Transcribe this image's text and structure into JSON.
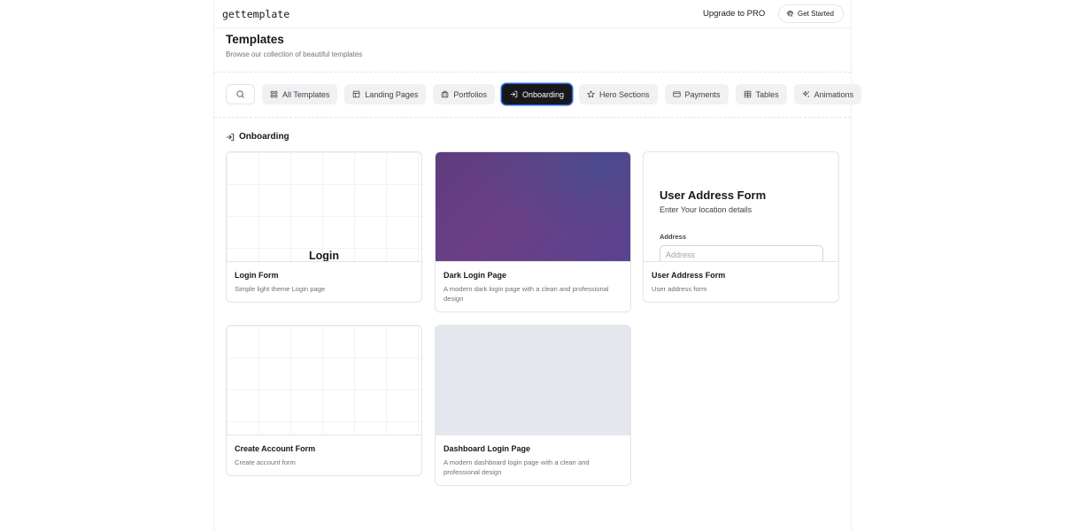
{
  "header": {
    "brand": "gettemplate",
    "upgrade_label": "Upgrade to PRO",
    "cta_label": "Get Started"
  },
  "page": {
    "title": "Templates",
    "subtitle": "Browse our collection of beautiful templates"
  },
  "tabs": [
    {
      "label": "All Templates",
      "icon": "grid-icon",
      "active": false
    },
    {
      "label": "Landing Pages",
      "icon": "layout-icon",
      "active": false
    },
    {
      "label": "Portfolios",
      "icon": "briefcase-icon",
      "active": false
    },
    {
      "label": "Onboarding",
      "icon": "log-in-icon",
      "active": true
    },
    {
      "label": "Hero Sections",
      "icon": "star-icon",
      "active": false
    },
    {
      "label": "Payments",
      "icon": "credit-card-icon",
      "active": false
    },
    {
      "label": "Tables",
      "icon": "table-icon",
      "active": false
    },
    {
      "label": "Animations",
      "icon": "sparkles-icon",
      "active": false
    }
  ],
  "section": {
    "title": "Onboarding",
    "icon": "log-in-icon"
  },
  "cards": [
    {
      "title": "Login Form",
      "description": "Simple light theme Login page",
      "preview_heading": "Login"
    },
    {
      "title": "Dark Login Page",
      "description": "A modern dark login page with a clean and professional design"
    },
    {
      "title": "User Address Form",
      "description": "User address form",
      "preview": {
        "heading": "User Address Form",
        "subheading": "Enter Your location details",
        "field_label": "Address",
        "field_placeholder": "Address"
      }
    },
    {
      "title": "Create Account Form",
      "description": "Create account form"
    },
    {
      "title": "Dashboard Login Page",
      "description": "A modern dashboard login page with a clean and professional design"
    }
  ],
  "colors": {
    "accent": "#18181b",
    "focus_ring": "#2563eb",
    "muted_text": "#71717a",
    "border": "#e4e4e7"
  }
}
